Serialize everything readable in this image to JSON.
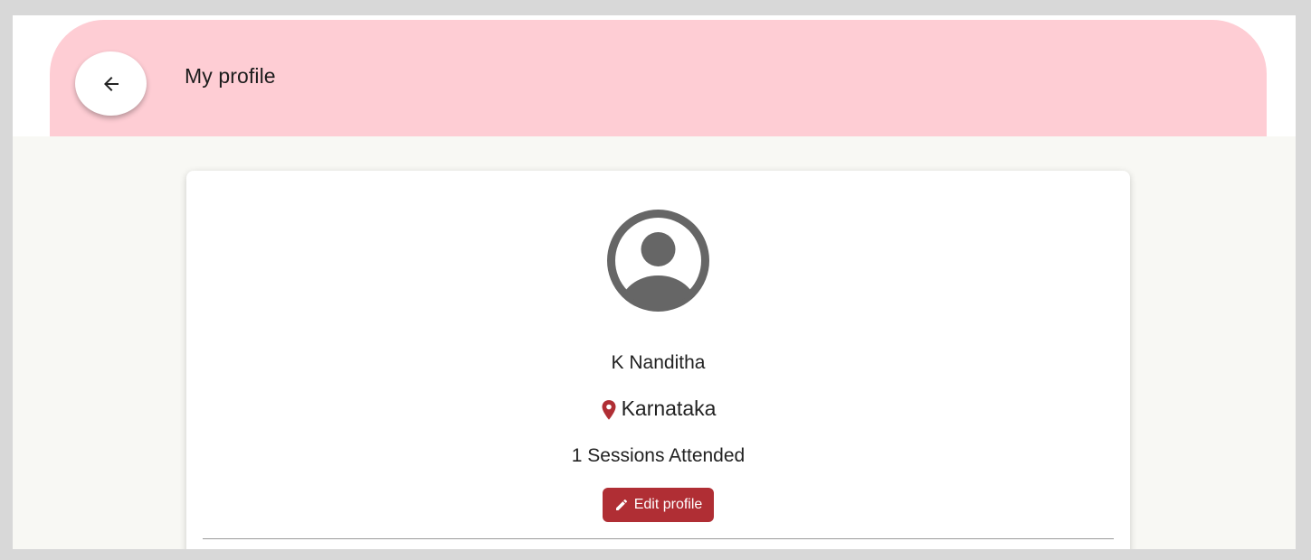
{
  "header": {
    "title": "My profile",
    "back_icon": "arrow-left-icon",
    "background_color": "#fecdd4"
  },
  "profile": {
    "avatar_icon": "account-circle-icon",
    "name": "K Nanditha",
    "location_icon": "map-pin-icon",
    "location": "Karnataka",
    "sessions": "1 Sessions Attended",
    "edit_icon": "pencil-icon",
    "edit_label": "Edit profile",
    "accent_color": "#b02e34"
  }
}
